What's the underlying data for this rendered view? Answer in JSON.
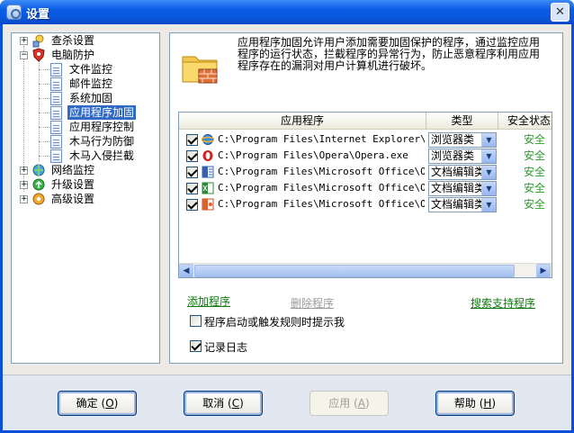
{
  "window": {
    "title": "设置",
    "close_glyph": "✕"
  },
  "tree": {
    "items": [
      {
        "label": "查杀设置",
        "level": 0,
        "expander": "+",
        "icon": "search-shield-icon"
      },
      {
        "label": "电脑防护",
        "level": 0,
        "expander": "−",
        "icon": "shield-guard-icon"
      },
      {
        "label": "文件监控",
        "level": 1,
        "icon": "document-icon"
      },
      {
        "label": "邮件监控",
        "level": 1,
        "icon": "document-icon"
      },
      {
        "label": "系统加固",
        "level": 1,
        "icon": "document-icon"
      },
      {
        "label": "应用程序加固",
        "level": 1,
        "icon": "document-icon",
        "selected": true
      },
      {
        "label": "应用程序控制",
        "level": 1,
        "icon": "document-icon"
      },
      {
        "label": "木马行为防御",
        "level": 1,
        "icon": "document-icon"
      },
      {
        "label": "木马入侵拦截",
        "level": 1,
        "icon": "document-icon"
      },
      {
        "label": "网络监控",
        "level": 0,
        "expander": "+",
        "icon": "network-globe-icon"
      },
      {
        "label": "升级设置",
        "level": 0,
        "expander": "+",
        "icon": "update-globe-icon"
      },
      {
        "label": "高级设置",
        "level": 0,
        "expander": "+",
        "icon": "advanced-gear-icon"
      }
    ]
  },
  "main": {
    "description": "应用程序加固允许用户添加需要加固保护的程序，通过监控应用程序的运行状态，拦截程序的异常行为，防止恶意程序利用应用程序存在的漏洞对用户计算机进行破坏。",
    "columns": {
      "app": "应用程序",
      "type": "类型",
      "status": "安全状态"
    },
    "rows": [
      {
        "checked": true,
        "icon": "internet-explorer-icon",
        "path": "C:\\Program Files\\Internet Explorer\\...",
        "type": "浏览器类",
        "status": "安全"
      },
      {
        "checked": true,
        "icon": "opera-icon",
        "path": "C:\\Program Files\\Opera\\Opera.exe",
        "type": "浏览器类",
        "status": "安全"
      },
      {
        "checked": true,
        "icon": "word-document-icon",
        "path": "C:\\Program Files\\Microsoft Office\\O...",
        "type": "文档编辑类",
        "status": "安全"
      },
      {
        "checked": true,
        "icon": "excel-document-icon",
        "path": "C:\\Program Files\\Microsoft Office\\O...",
        "type": "文档编辑类",
        "status": "安全"
      },
      {
        "checked": true,
        "icon": "powerpoint-document-icon",
        "path": "C:\\Program Files\\Microsoft Office\\O...",
        "type": "文档编辑类",
        "status": "安全"
      }
    ],
    "add_link": "添加程序",
    "remove_link": "删除程序",
    "search_link": "搜索支持程序",
    "prompt_checkbox": {
      "label": "程序启动或触发规则时提示我",
      "checked": false
    },
    "log_checkbox": {
      "label": "记录日志",
      "checked": true
    }
  },
  "buttons": {
    "ok": "确定",
    "ok_key": "O",
    "cancel": "取消",
    "cancel_key": "C",
    "apply": "应用",
    "apply_key": "A",
    "help": "帮助",
    "help_key": "H"
  },
  "colors": {
    "title_bar": "#0b5ce6",
    "selection": "#316ac5",
    "status_safe": "#2e9b2e",
    "link_green": "#0e7a0e"
  }
}
